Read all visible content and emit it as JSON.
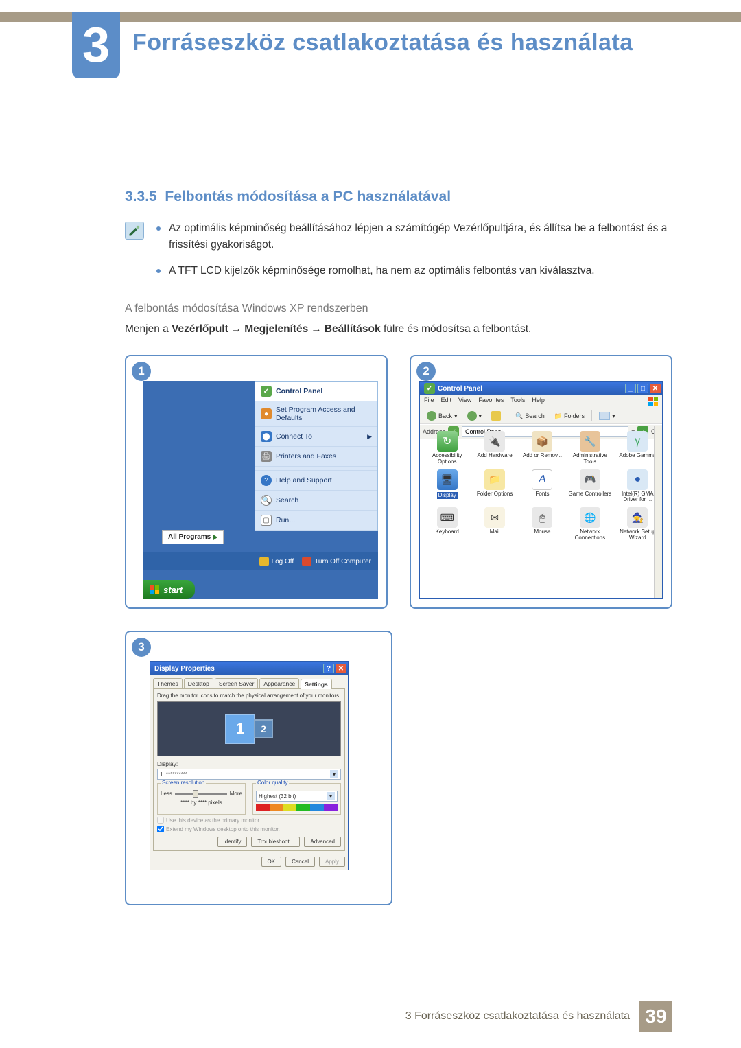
{
  "chapter": {
    "num": "3",
    "title": "Forráseszköz csatlakoztatása és használata"
  },
  "section": {
    "num": "3.3.5",
    "title": "Felbontás módosítása a PC használatával"
  },
  "bullets": [
    "Az optimális képminőség beállításához lépjen a számítógép Vezérlőpultjára, és állítsa be a felbontást és a frissítési gyakoriságot.",
    "A TFT LCD kijelzők képminősége romolhat, ha nem az optimális felbontás van kiválasztva."
  ],
  "subheading": "A felbontás módosítása Windows XP rendszerben",
  "instruction": {
    "pre": "Menjen a ",
    "b1": "Vezérlőpult",
    "b2": "Megjelenítés",
    "b3": "Beállítások",
    "post": " fülre és módosítsa a felbontást."
  },
  "panel1": {
    "num": "1",
    "items": {
      "control_panel": "Control Panel",
      "set_access": "Set Program Access and Defaults",
      "connect_to": "Connect To",
      "printers": "Printers and Faxes",
      "help": "Help and Support",
      "search": "Search",
      "run": "Run..."
    },
    "all_programs": "All Programs",
    "log_off": "Log Off",
    "turn_off": "Turn Off Computer",
    "start": "start"
  },
  "panel2": {
    "num": "2",
    "title": "Control Panel",
    "menu": [
      "File",
      "Edit",
      "View",
      "Favorites",
      "Tools",
      "Help"
    ],
    "toolbar": {
      "back": "Back",
      "search": "Search",
      "folders": "Folders"
    },
    "address_label": "Address",
    "address_value": "Control Panel",
    "go": "Go",
    "icons": [
      {
        "k": "pc-acc",
        "l": "Accessibility Options"
      },
      {
        "k": "pc-hw",
        "l": "Add Hardware"
      },
      {
        "k": "pc-arp",
        "l": "Add or Remov..."
      },
      {
        "k": "pc-admin",
        "l": "Administrative Tools"
      },
      {
        "k": "pc-gamma",
        "l": "Adobe Gamma"
      },
      {
        "k": "pc-disp",
        "l": "Display",
        "sel": true
      },
      {
        "k": "pc-fold",
        "l": "Folder Options"
      },
      {
        "k": "pc-font",
        "l": "Fonts"
      },
      {
        "k": "pc-game",
        "l": "Game Controllers"
      },
      {
        "k": "pc-intel",
        "l": "Intel(R) GMA Driver for ..."
      },
      {
        "k": "pc-kb",
        "l": "Keyboard"
      },
      {
        "k": "pc-mail",
        "l": "Mail"
      },
      {
        "k": "pc-mouse",
        "l": "Mouse"
      },
      {
        "k": "pc-net",
        "l": "Network Connections"
      },
      {
        "k": "pc-wiz",
        "l": "Network Setup Wizard"
      }
    ]
  },
  "panel3": {
    "num": "3",
    "title": "Display Properties",
    "tabs": [
      "Themes",
      "Desktop",
      "Screen Saver",
      "Appearance",
      "Settings"
    ],
    "drag_note": "Drag the monitor icons to match the physical arrangement of your monitors.",
    "mon1": "1",
    "mon2": "2",
    "display_lbl": "Display:",
    "display_val": "1. **********",
    "sr_title": "Screen resolution",
    "sr_less": "Less",
    "sr_more": "More",
    "sr_val": "**** by **** pixels",
    "cq_title": "Color quality",
    "cq_val": "Highest (32 bit)",
    "ck1": "Use this device as the primary monitor.",
    "ck2": "Extend my Windows desktop onto this monitor.",
    "btn_ident": "Identify",
    "btn_trouble": "Troubleshoot...",
    "btn_adv": "Advanced",
    "btn_ok": "OK",
    "btn_cancel": "Cancel",
    "btn_apply": "Apply"
  },
  "footer": {
    "text": "3 Forráseszköz csatlakoztatása és használata",
    "page": "39"
  }
}
